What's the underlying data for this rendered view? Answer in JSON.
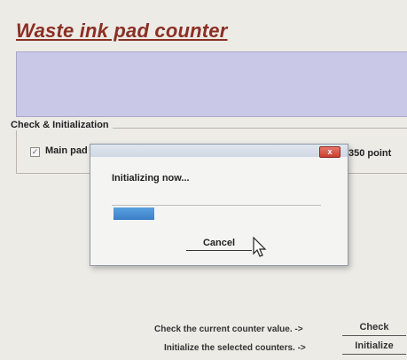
{
  "window": {
    "title": "Waste ink pad counter"
  },
  "check_init": {
    "group_label": "Check & Initialization",
    "main_pad": {
      "checkbox_mark": "✓",
      "label": "Main pad",
      "points_label": "350 point"
    }
  },
  "actions": {
    "check_row_label": "Check the current counter value. ->",
    "check_button": "Check",
    "init_row_label": "Initialize the selected counters. ->",
    "init_button": "Initialize"
  },
  "dialog": {
    "close_glyph": "x",
    "message": "Initializing now...",
    "progress_fraction": 0.2,
    "cancel_button": "Cancel"
  },
  "icons": {
    "close": "close-icon",
    "cursor": "mouse-pointer-icon"
  },
  "colors": {
    "title": "#8c2f24",
    "banner": "#c9c8e6",
    "progress": "#3b7fc6",
    "close_button": "#c83f2f"
  }
}
